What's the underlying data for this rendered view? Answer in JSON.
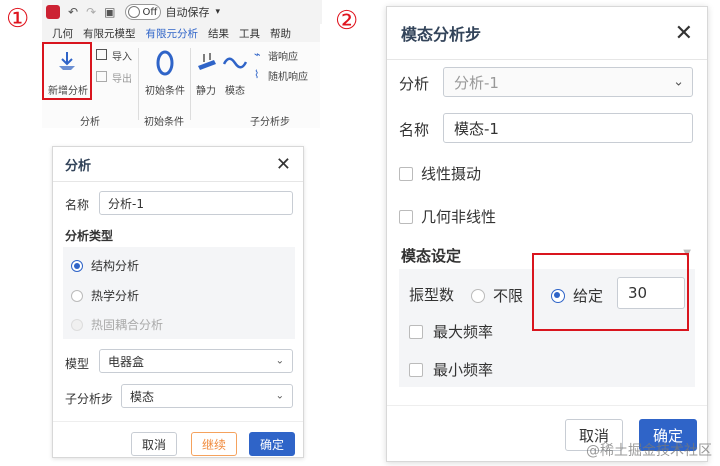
{
  "steps": {
    "one": "①",
    "two": "②"
  },
  "toolbar": {
    "save_toggle_state": "Off",
    "auto_save_label": "自动保存",
    "more": "▾"
  },
  "tabs": [
    "几何",
    "有限元模型",
    "有限元分析",
    "结果",
    "工具",
    "帮助"
  ],
  "active_tab": "有限元分析",
  "ribbon": {
    "new_analysis": "新增分析",
    "import": "导入",
    "export": "导出",
    "initial_conditions": "初始条件",
    "static": "静力",
    "modal": "模态",
    "harmonic": "谐响应",
    "random": "随机响应",
    "group_analysis": "分析",
    "group_initial": "初始条件",
    "group_substep": "子分析步"
  },
  "analysis_dialog": {
    "title": "分析",
    "name_label": "名称",
    "name_value": "分析-1",
    "type_heading": "分析类型",
    "types": [
      {
        "label": "结构分析",
        "state": "checked"
      },
      {
        "label": "热学分析",
        "state": "unchecked"
      },
      {
        "label": "热固耦合分析",
        "state": "disabled"
      }
    ],
    "model_label": "模型",
    "model_value": "电器盒",
    "substep_label": "子分析步",
    "substep_value": "模态",
    "cancel": "取消",
    "continue": "继续",
    "confirm": "确定"
  },
  "modal_dialog": {
    "title": "模态分析步",
    "analysis_label": "分析",
    "analysis_value": "分析-1",
    "name_label": "名称",
    "name_value": "模态-1",
    "linear_perturbation": "线性摄动",
    "geometric_nonlinear": "几何非线性",
    "settings_heading": "模态设定",
    "mode_count_label": "振型数",
    "unlimited": "不限",
    "given": "给定",
    "given_value": "30",
    "max_freq": "最大频率",
    "min_freq": "最小频率",
    "cancel": "取消",
    "confirm": "确定"
  },
  "watermark": "@稀土掘金技术社区",
  "colors": {
    "accent": "#2f64c8",
    "highlight": "#d9151e",
    "warn": "#f08a3c"
  }
}
